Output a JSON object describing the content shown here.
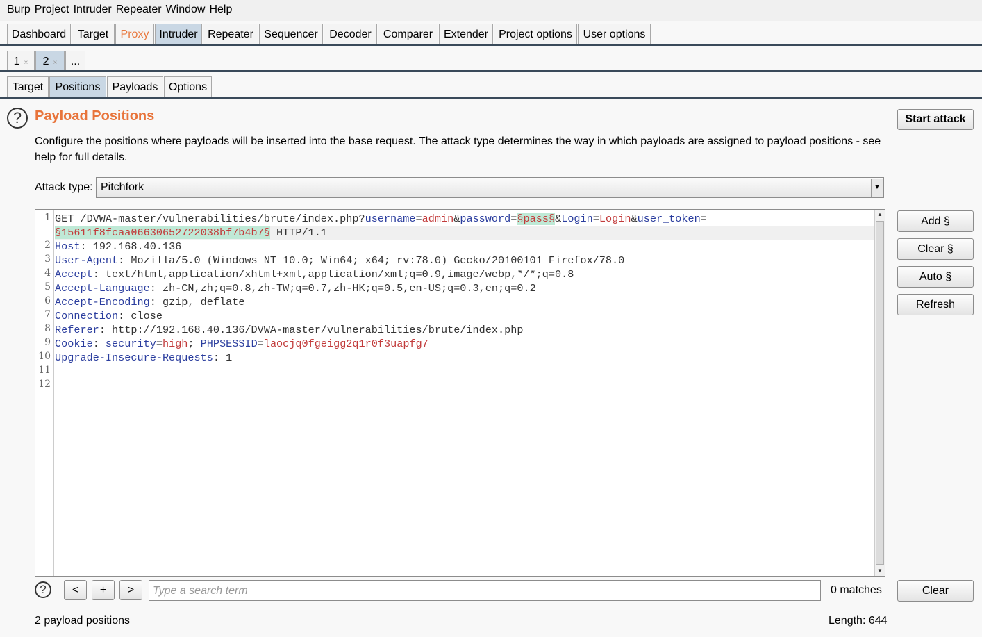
{
  "menu": [
    "Burp",
    "Project",
    "Intruder",
    "Repeater",
    "Window",
    "Help"
  ],
  "main_tabs": [
    "Dashboard",
    "Target",
    "Proxy",
    "Intruder",
    "Repeater",
    "Sequencer",
    "Decoder",
    "Comparer",
    "Extender",
    "Project options",
    "User options"
  ],
  "attack_tabs": {
    "tab1": "1",
    "tab2": "2",
    "more": "...",
    "close": "×"
  },
  "sub_tabs": [
    "Target",
    "Positions",
    "Payloads",
    "Options"
  ],
  "section": {
    "help_icon": "?",
    "title": "Payload Positions",
    "description": "Configure the positions where payloads will be inserted into the base request. The attack type determines the way in which payloads are assigned to payload positions - see help for full details."
  },
  "buttons": {
    "start_attack": "Start attack",
    "add": "Add §",
    "clear_markers": "Clear §",
    "auto": "Auto §",
    "refresh": "Refresh",
    "clear": "Clear"
  },
  "attack_type": {
    "label": "Attack type:",
    "value": "Pitchfork",
    "arrow": "▼"
  },
  "editor": {
    "line_numbers": [
      "1",
      "2",
      "3",
      "4",
      "5",
      "6",
      "7",
      "8",
      "9",
      "10",
      "11",
      "12"
    ],
    "line1": {
      "method": "GET /DVWA-master/vulnerabilities/brute/index.php?",
      "p1k": "username",
      "eq": "=",
      "p1v": "admin",
      "amp": "&",
      "p2k": "password",
      "p2v": "§pass§",
      "p3k": "Login",
      "p3v": "Login",
      "p4k": "user_token",
      "p4v": "§15611f8fcaa06630652722038bf7b4b7§",
      "proto": " HTTP/1.1"
    },
    "headers": [
      {
        "name": "Host",
        "sep": ": ",
        "value": "192.168.40.136"
      },
      {
        "name": "User-Agent",
        "sep": ": ",
        "value": "Mozilla/5.0 (Windows NT 10.0; Win64; x64; rv:78.0) Gecko/20100101 Firefox/78.0"
      },
      {
        "name": "Accept",
        "sep": ": ",
        "value": "text/html,application/xhtml+xml,application/xml;q=0.9,image/webp,*/*;q=0.8"
      },
      {
        "name": "Accept-Language",
        "sep": ": ",
        "value": "zh-CN,zh;q=0.8,zh-TW;q=0.7,zh-HK;q=0.5,en-US;q=0.3,en;q=0.2"
      },
      {
        "name": "Accept-Encoding",
        "sep": ": ",
        "value": "gzip, deflate"
      },
      {
        "name": "Connection",
        "sep": ": ",
        "value": "close"
      },
      {
        "name": "Referer",
        "sep": ": ",
        "value": "http://192.168.40.136/DVWA-master/vulnerabilities/brute/index.php"
      }
    ],
    "cookie": {
      "name": "Cookie",
      "sep": ": ",
      "k1": "security",
      "eq": "=",
      "v1": "high",
      "semi": "; ",
      "k2": "PHPSESSID",
      "v2": "laocjq0fgeigg2q1r0f3uapfg7"
    },
    "upgrade": {
      "name": "Upgrade-Insecure-Requests",
      "sep": ": ",
      "value": "1"
    }
  },
  "search": {
    "help_icon": "?",
    "prev": "<",
    "add": "+",
    "next": ">",
    "placeholder": "Type a search term",
    "matches": "0 matches"
  },
  "status": {
    "positions": "2 payload positions",
    "length": "Length: 644"
  }
}
